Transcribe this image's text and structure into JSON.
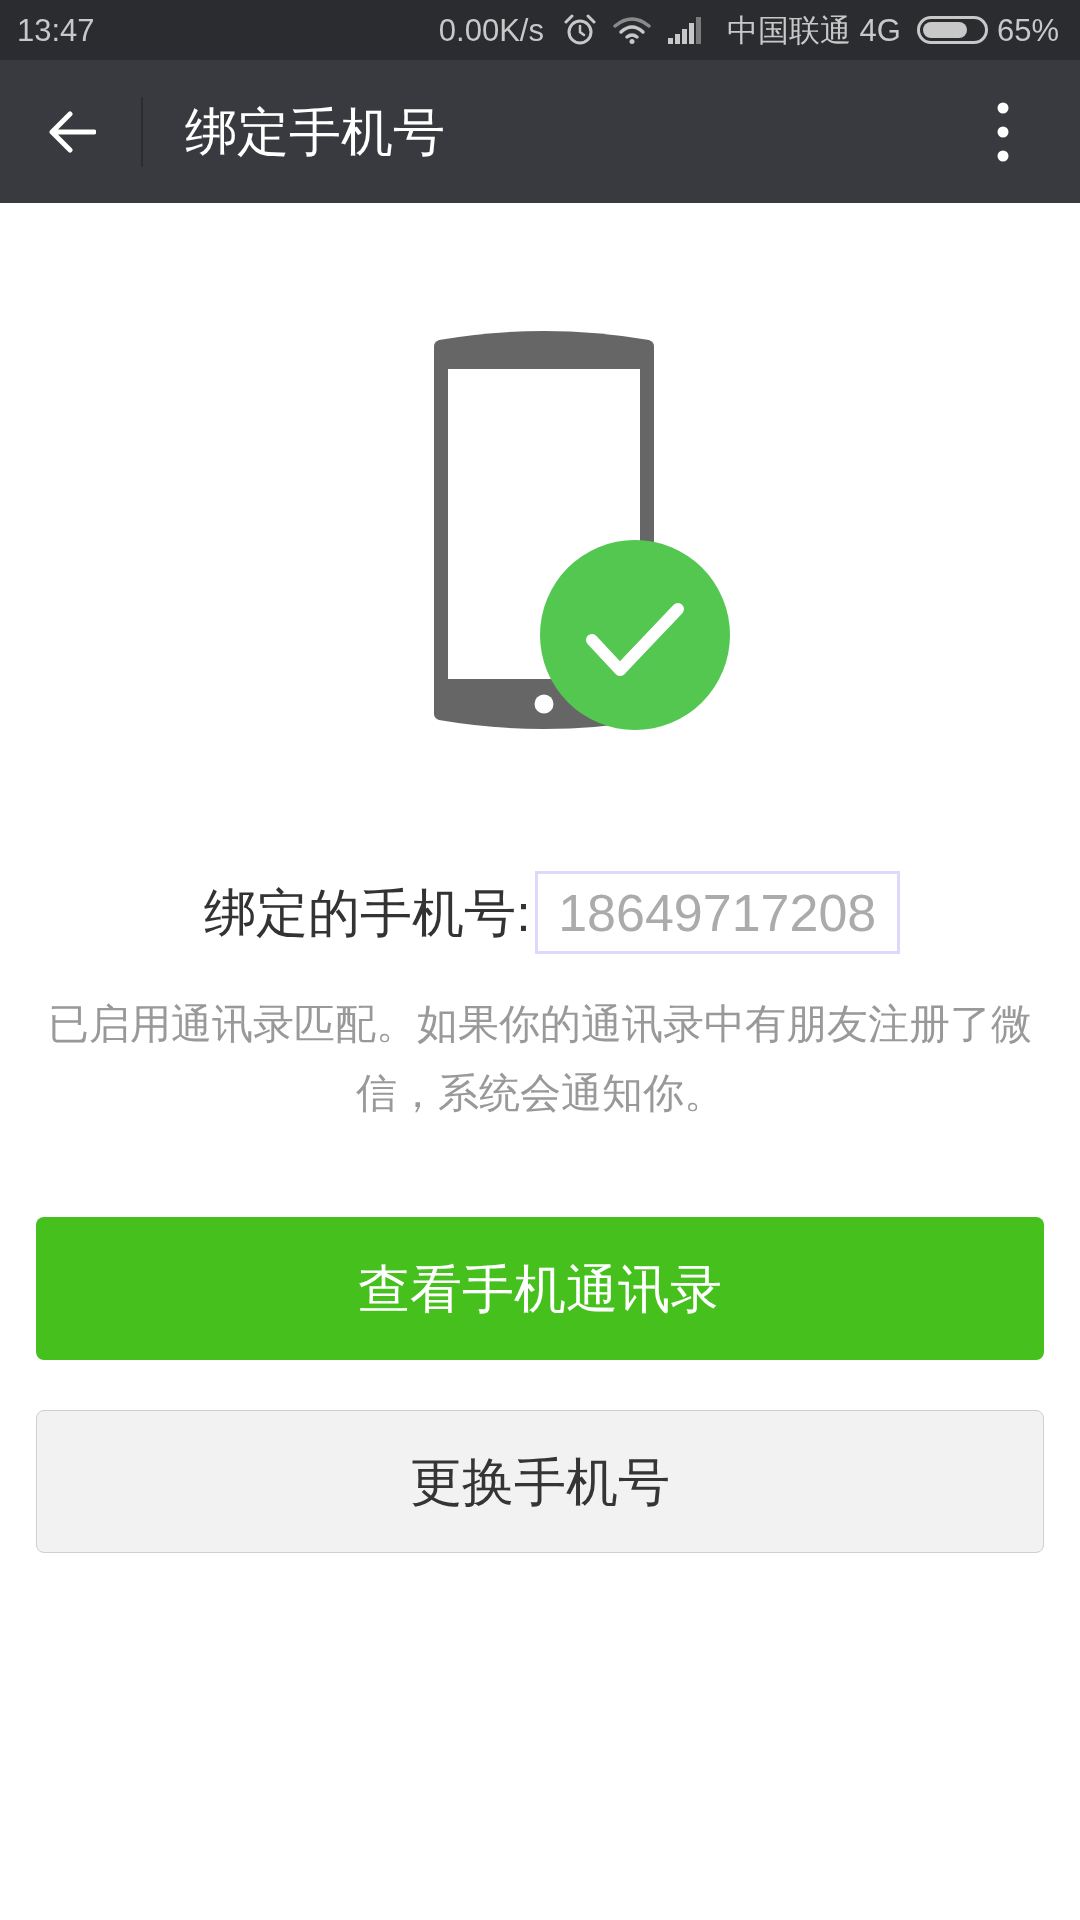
{
  "status_bar": {
    "time": "13:47",
    "network_speed": "0.00K/s",
    "carrier": "中国联通 4G",
    "battery": "65%"
  },
  "app_bar": {
    "title": "绑定手机号"
  },
  "bound_number": {
    "label": "绑定的手机号:",
    "value": "18649717208"
  },
  "notice": "已启用通讯录匹配。如果你的通讯录中有朋友注册了微信，系统会通知你。",
  "buttons": [
    {
      "label": "查看手机通讯录",
      "kind": "primary"
    },
    {
      "label": "更换手机号",
      "kind": "secondary"
    }
  ]
}
